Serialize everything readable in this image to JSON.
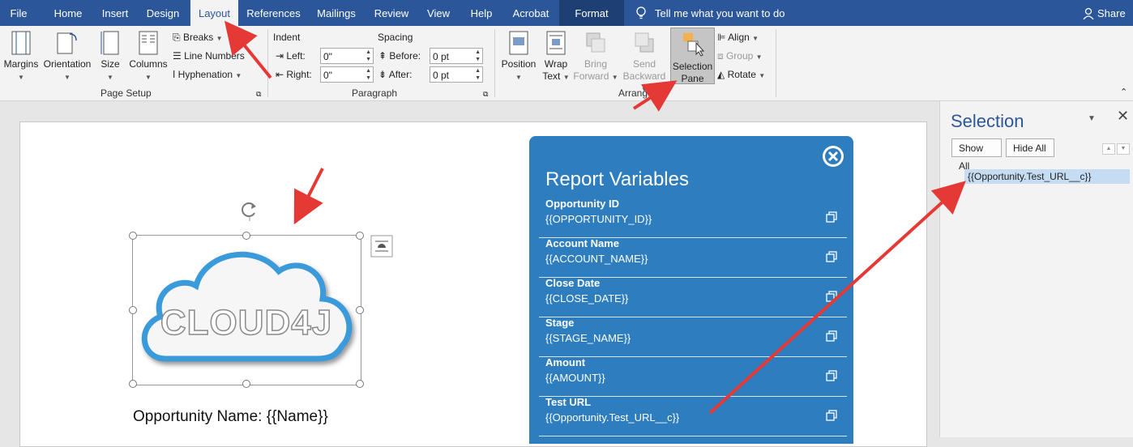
{
  "tabs": [
    "File",
    "Home",
    "Insert",
    "Design",
    "Layout",
    "References",
    "Mailings",
    "Review",
    "View",
    "Help",
    "Acrobat",
    "Format"
  ],
  "tell_me": "Tell me what you want to do",
  "share": "Share",
  "page_setup": {
    "margins": "Margins",
    "orientation": "Orientation",
    "size": "Size",
    "columns": "Columns",
    "breaks": "Breaks",
    "line_numbers": "Line Numbers",
    "hyphenation": "Hyphenation",
    "group_label": "Page Setup"
  },
  "paragraph": {
    "indent_label": "Indent",
    "spacing_label": "Spacing",
    "left_label": "Left:",
    "right_label": "Right:",
    "before_label": "Before:",
    "after_label": "After:",
    "left_value": "0\"",
    "right_value": "0\"",
    "before_value": "0 pt",
    "after_value": "0 pt",
    "group_label": "Paragraph"
  },
  "arrange": {
    "position": "Position",
    "wrap_1": "Wrap",
    "wrap_2": "Text",
    "bring_1": "Bring",
    "bring_2": "Forward",
    "send_1": "Send",
    "send_2": "Backward",
    "selection_1": "Selection",
    "selection_2": "Pane",
    "align": "Align",
    "group": "Group",
    "rotate": "Rotate",
    "group_label": "Arrange"
  },
  "document": {
    "logo_text": "CLOUD4J",
    "opportunity_line": "Opportunity Name: {{Name}}"
  },
  "report_panel": {
    "title": "Report Variables",
    "items": [
      {
        "label": "Opportunity ID",
        "value": "{{OPPORTUNITY_ID}}"
      },
      {
        "label": "Account Name",
        "value": "{{ACCOUNT_NAME}}"
      },
      {
        "label": "Close Date",
        "value": "{{CLOSE_DATE}}"
      },
      {
        "label": "Stage",
        "value": "{{STAGE_NAME}}"
      },
      {
        "label": "Amount",
        "value": "{{AMOUNT}}"
      },
      {
        "label": "Test URL",
        "value": "{{Opportunity.Test_URL__c}}"
      }
    ]
  },
  "selection_pane": {
    "title": "Selection",
    "show_all": "Show All",
    "hide_all": "Hide All",
    "item": "{{Opportunity.Test_URL__c}}"
  },
  "colors": {
    "word_blue": "#2b579a",
    "panel_blue": "#2d7dbf",
    "arrow_red": "#e53935"
  }
}
